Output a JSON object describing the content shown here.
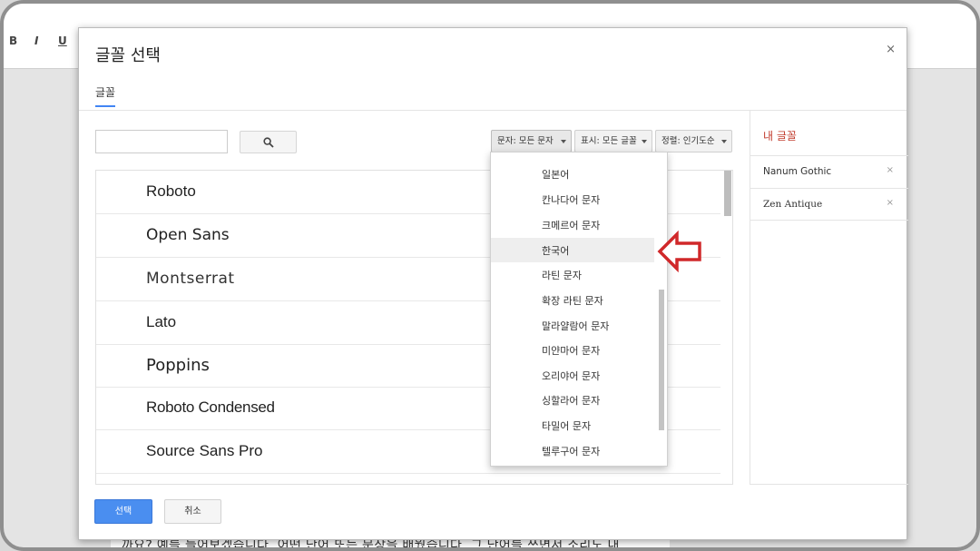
{
  "toolbar": {
    "bold": "B",
    "italic": "I",
    "underline": "U"
  },
  "doc": {
    "text": "까요? 예를 들어보겠습니다. 어떤 단어 또는 문장을 배웠습니다. 그 단어를 쓰면서 소리도 내"
  },
  "dialog": {
    "title": "글꼴 선택",
    "close": "×",
    "tab": "글꼴",
    "search": {
      "value": "",
      "placeholder": ""
    },
    "filters": {
      "script": "문자: 모든 문자",
      "show": "표시: 모든 글꼴",
      "sort": "정렬: 인기도순"
    },
    "fonts": [
      "Roboto",
      "Open Sans",
      "Montserrat",
      "Lato",
      "Poppins",
      "Roboto Condensed",
      "Source Sans Pro"
    ],
    "my_fonts": {
      "title": "내 글꼴",
      "items": [
        {
          "name": "Nanum Gothic",
          "remove": "×"
        },
        {
          "name": "Zen Antique",
          "remove": "×"
        }
      ]
    },
    "ok": "선택",
    "cancel": "취소"
  },
  "dropdown": {
    "items": [
      "일본어",
      "칸나다어 문자",
      "크메르어 문자",
      "한국어",
      "라틴 문자",
      "확장 라틴 문자",
      "말라얄람어 문자",
      "미얀마어 문자",
      "오리야어 문자",
      "싱할라어 문자",
      "타밀어 문자",
      "텔루구어 문자"
    ],
    "highlighted": "한국어"
  },
  "colors": {
    "accent": "#4285f4",
    "ok_button": "#4a8ef0",
    "my_fonts_title": "#c0392b",
    "arrow": "#d0282a"
  },
  "icons": {
    "search": "search-icon",
    "arrow": "arrow-left-outline-icon"
  }
}
